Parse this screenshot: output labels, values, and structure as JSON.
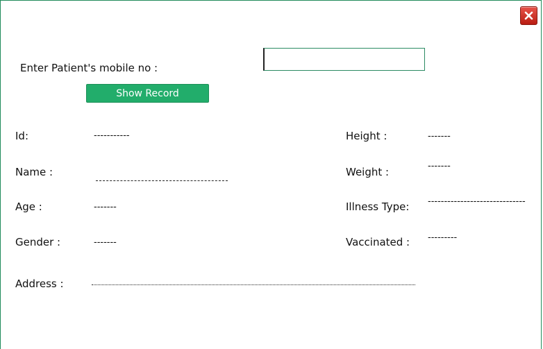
{
  "form": {
    "mobile_label": "Enter Patient's mobile no :",
    "mobile_value": "",
    "show_button": "Show Record"
  },
  "left_fields": {
    "id_label": "Id:",
    "id_value": "-----------",
    "name_label": "Name :",
    "name_value": "",
    "age_label": "Age :",
    "age_value": "-------",
    "gender_label": "Gender :",
    "gender_value": "-------",
    "address_label": "Address :",
    "address_value": ""
  },
  "right_fields": {
    "height_label": "Height :",
    "height_value": "-------",
    "weight_label": "Weight :",
    "weight_value": "-------",
    "illness_label": "Illness Type:",
    "illness_value": "------------------------------",
    "vaccinated_label": "Vaccinated :",
    "vaccinated_value": "---------"
  },
  "colors": {
    "accent": "#22ad6b",
    "window_border": "#1f8a5a",
    "close_button": "#c9281c"
  },
  "icons": {
    "close": "close-icon"
  }
}
